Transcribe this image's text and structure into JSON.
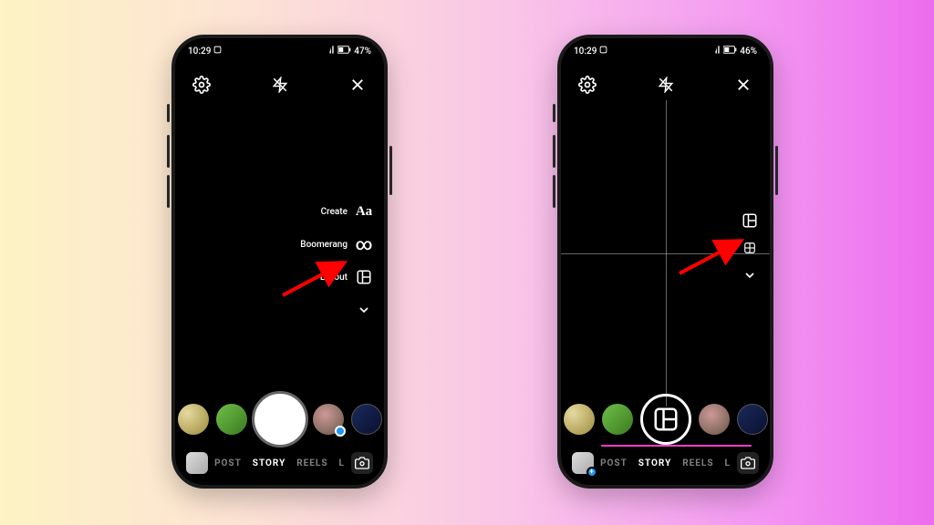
{
  "left": {
    "status": {
      "time": "10:29",
      "battery": "47%"
    },
    "side_tools": {
      "create": "Create",
      "boomerang": "Boomerang",
      "layout": "Layout"
    },
    "modes": {
      "post": "POST",
      "story": "STORY",
      "reels": "REELS",
      "live": "L"
    }
  },
  "right": {
    "status": {
      "time": "10:29",
      "battery": "46%"
    },
    "modes": {
      "post": "POST",
      "story": "STORY",
      "reels": "REELS",
      "live": "L"
    }
  }
}
